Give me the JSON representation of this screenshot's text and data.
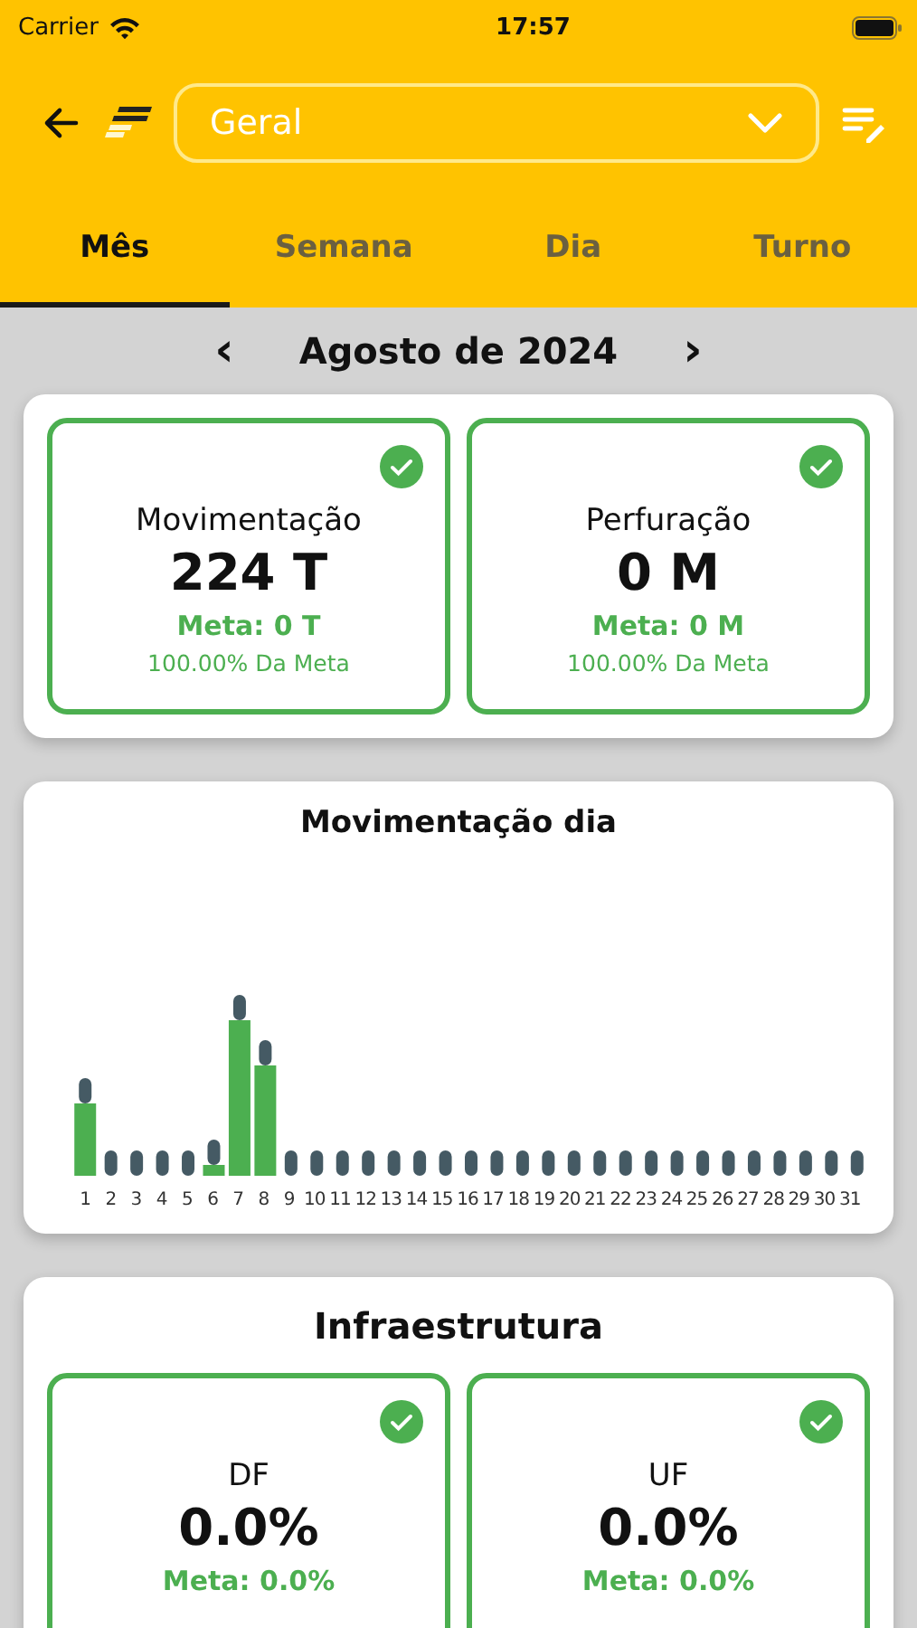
{
  "status_bar": {
    "carrier": "Carrier",
    "time": "17:57"
  },
  "header": {
    "selector": {
      "value": "Geral"
    }
  },
  "tabs": [
    {
      "label": "Mês",
      "selected": true
    },
    {
      "label": "Semana",
      "selected": false
    },
    {
      "label": "Dia",
      "selected": false
    },
    {
      "label": "Turno",
      "selected": false
    }
  ],
  "period": {
    "prev": "‹",
    "label": "Agosto de 2024",
    "next": "›"
  },
  "production": [
    {
      "title": "Movimentação",
      "value": "224 T",
      "meta": "Meta: 0 T",
      "percent": "100.00% Da Meta",
      "achieved": true
    },
    {
      "title": "Perfuração",
      "value": "0 M",
      "meta": "Meta: 0 M",
      "percent": "100.00% Da Meta",
      "achieved": true
    }
  ],
  "chart": {
    "title": "Movimentação dia",
    "days": [
      "1",
      "2",
      "3",
      "4",
      "5",
      "6",
      "7",
      "8",
      "9",
      "10",
      "11",
      "12",
      "13",
      "14",
      "15",
      "16",
      "17",
      "18",
      "19",
      "20",
      "21",
      "22",
      "23",
      "24",
      "25",
      "26",
      "27",
      "28",
      "29",
      "30",
      "31"
    ]
  },
  "infra": {
    "title": "Infraestrutura",
    "cards": [
      {
        "title": "DF",
        "value": "0.0%",
        "meta": "Meta: 0.0%",
        "achieved": true
      },
      {
        "title": "UF",
        "value": "0.0%",
        "meta": "Meta: 0.0%",
        "achieved": true
      }
    ]
  }
}
